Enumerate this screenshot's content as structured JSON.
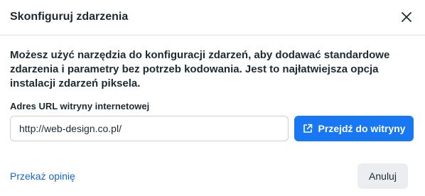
{
  "dialog": {
    "title": "Skonfiguruj zdarzenia",
    "close_icon": "close-icon",
    "description": "Możesz użyć narzędzia do konfiguracji zdarzeń, aby dodawać standardowe zdarzenia i parametry bez potrzeb kodowania. Jest to najłatwiejsza opcja instalacji zdarzeń piksela.",
    "url_field": {
      "label": "Adres URL witryny internetowej",
      "value": "http://web-design.co.pl/"
    },
    "go_button": {
      "label": "Przejdź do witryny",
      "icon": "external-link-icon"
    },
    "feedback_link": "Przekaż opinię",
    "cancel_button": "Anuluj",
    "colors": {
      "primary": "#1877f2",
      "link": "#1466c6",
      "secondary_button_bg": "#ebedf0"
    }
  }
}
